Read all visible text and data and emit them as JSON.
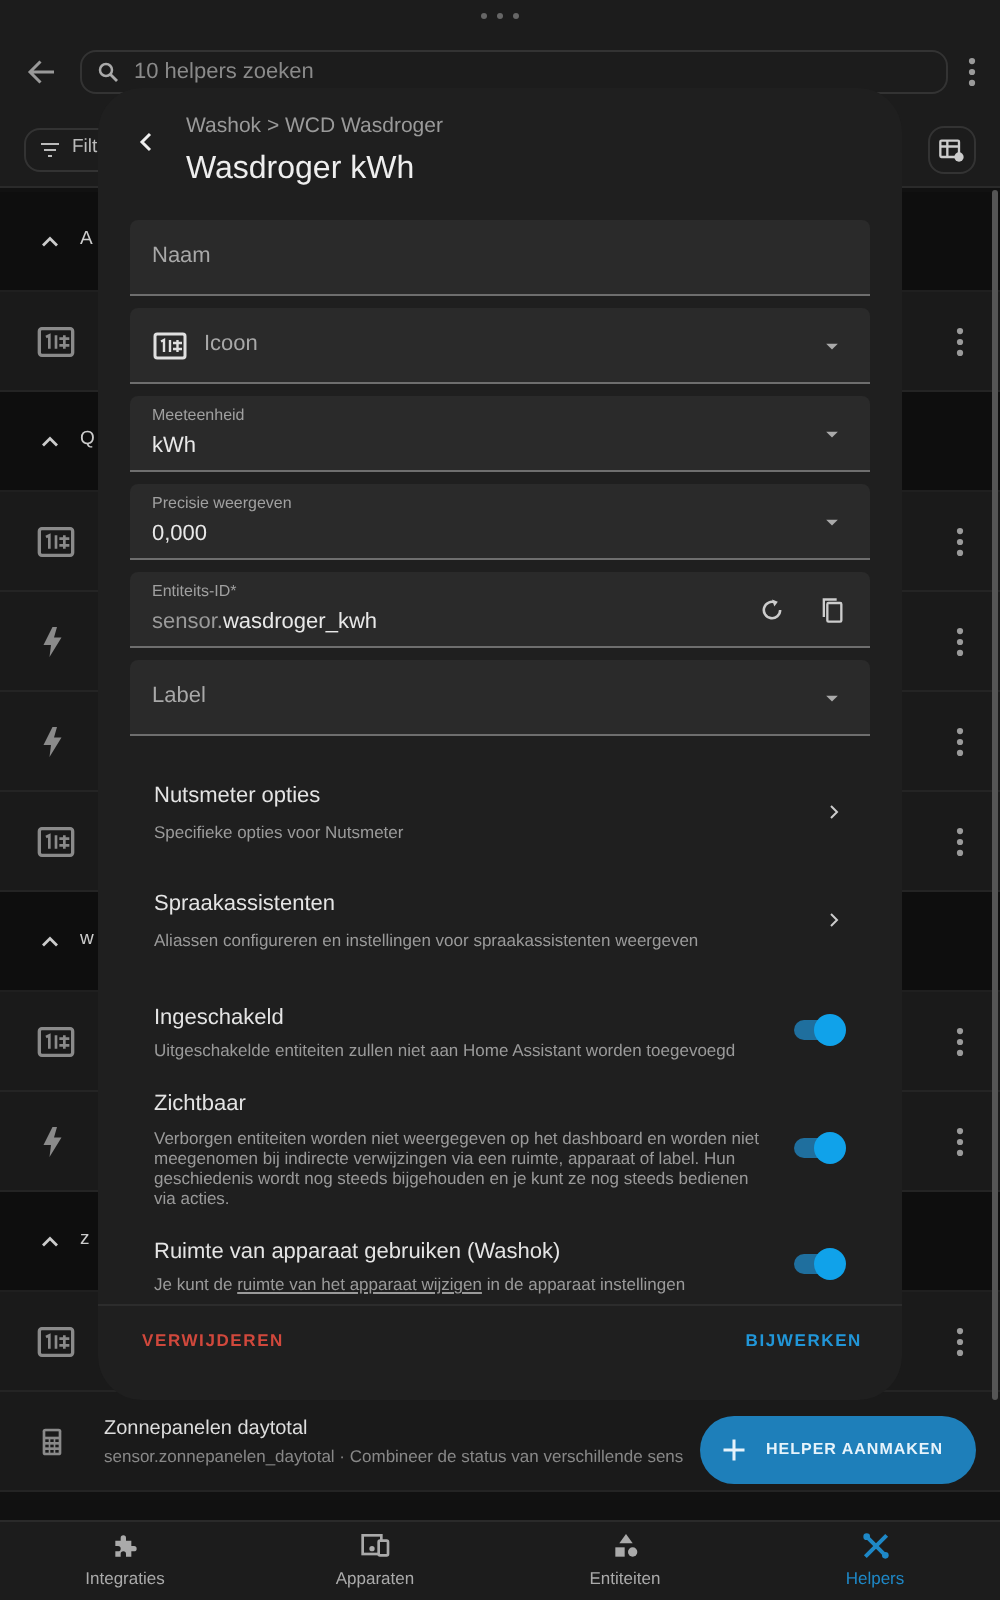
{
  "top_bar": {
    "search_placeholder": "10 helpers zoeken"
  },
  "filter_button": {
    "label": "Filt"
  },
  "list": [
    {
      "kind": "group",
      "label": "A",
      "expanded": true
    },
    {
      "kind": "counter"
    },
    {
      "kind": "group",
      "label": "Q",
      "expanded": true
    },
    {
      "kind": "counter"
    },
    {
      "kind": "energy"
    },
    {
      "kind": "energy"
    },
    {
      "kind": "counter"
    },
    {
      "kind": "group",
      "label": "w",
      "expanded": true
    },
    {
      "kind": "counter"
    },
    {
      "kind": "energy"
    },
    {
      "kind": "group",
      "label": "z",
      "expanded": true
    },
    {
      "kind": "counter"
    },
    {
      "kind": "calculator",
      "title": "Zonnepanelen daytotal",
      "subtitle": "sensor.zonnepanelen_daytotal · Combineer de status van verschillende sens"
    }
  ],
  "fab": {
    "label": "HELPER AANMAKEN"
  },
  "dialog": {
    "breadcrumb": "Washok > WCD Wasdroger",
    "title": "Wasdroger kWh",
    "fields": [
      {
        "kind": "text",
        "label": "Naam"
      },
      {
        "kind": "icon_select",
        "label": "Icoon"
      },
      {
        "kind": "select",
        "label": "Meeteenheid",
        "value": "kWh"
      },
      {
        "kind": "select",
        "label": "Precisie weergeven",
        "value": "0,000"
      },
      {
        "kind": "entity",
        "label": "Entiteits-ID*",
        "prefix": "sensor.",
        "value": "wasdroger_kwh"
      },
      {
        "kind": "select",
        "label": "Label"
      }
    ],
    "links": [
      {
        "title": "Nutsmeter opties",
        "description": "Specifieke opties voor Nutsmeter"
      },
      {
        "title": "Spraakassistenten",
        "description": "Aliassen configureren en instellingen voor spraakassistenten weergeven"
      }
    ],
    "toggles": [
      {
        "title": "Ingeschakeld",
        "description": "Uitgeschakelde entiteiten zullen niet aan Home Assistant worden toegevoegd",
        "on": true
      },
      {
        "title": "Zichtbaar",
        "description": "Verborgen entiteiten worden niet weergegeven op het dashboard en worden niet meegenomen bij indirecte verwijzingen via een ruimte, apparaat of label. Hun geschiedenis wordt nog steeds bijgehouden en je kunt ze nog steeds bedienen via acties.",
        "on": true
      },
      {
        "title": "Ruimte van apparaat gebruiken (Washok)",
        "description": "Je kunt de ",
        "link": "ruimte van het apparaat wijzigen",
        "description_after": " in de apparaat instellingen",
        "on": true
      }
    ],
    "delete_button": "VERWIJDEREN",
    "update_button": "BIJWERKEN"
  },
  "bottom_nav": [
    {
      "label": "Integraties",
      "selected": false
    },
    {
      "label": "Apparaten",
      "selected": false
    },
    {
      "label": "Entiteiten",
      "selected": false
    },
    {
      "label": "Helpers",
      "selected": true
    }
  ]
}
